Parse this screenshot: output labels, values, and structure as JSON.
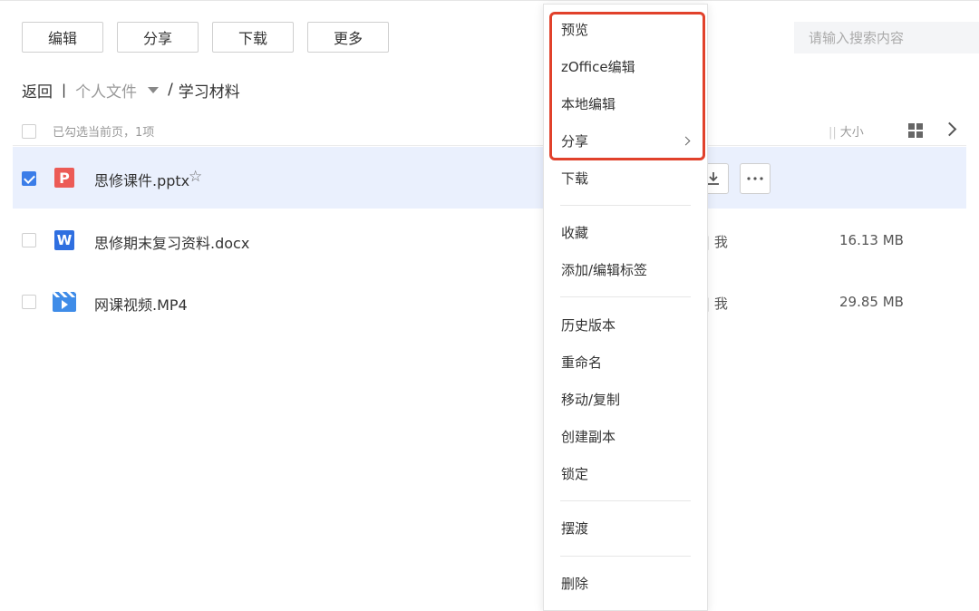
{
  "toolbar": {
    "edit": "编辑",
    "share": "分享",
    "download": "下载",
    "more": "更多"
  },
  "search": {
    "placeholder": "请输入搜索内容"
  },
  "breadcrumb": {
    "back": "返回",
    "separator": "|",
    "personal": "个人文件",
    "slash": "/",
    "current": "学习材料"
  },
  "list_header": {
    "selected_text": "已勾选当前页，1项",
    "size_bars": "||",
    "size_label": "大小"
  },
  "files": [
    {
      "name": "思修课件.pptx",
      "icon": "pptx-icon",
      "checked": true,
      "owner": "",
      "size": ""
    },
    {
      "name": "思修期末复习资料.docx",
      "icon": "docx-icon",
      "checked": false,
      "owner": "| 我",
      "size": "16.13 MB"
    },
    {
      "name": "网课视频.MP4",
      "icon": "video-icon",
      "checked": false,
      "owner": "| 我",
      "size": "29.85 MB"
    }
  ],
  "icon_letters": {
    "pptx": "P",
    "docx": "W"
  },
  "context_menu": {
    "items": [
      "预览",
      "zOffice编辑",
      "本地编辑",
      "分享",
      "下载",
      "收藏",
      "添加/编辑标签",
      "历史版本",
      "重命名",
      "移动/复制",
      "创建副本",
      "锁定",
      "摆渡",
      "删除"
    ]
  },
  "colors": {
    "accent": "#3b7de8",
    "selected_row": "#eaf0fd",
    "highlight": "#e1412b",
    "pptx": "#ec5b56",
    "docx": "#2f6fe0",
    "video": "#3f8ce8"
  }
}
